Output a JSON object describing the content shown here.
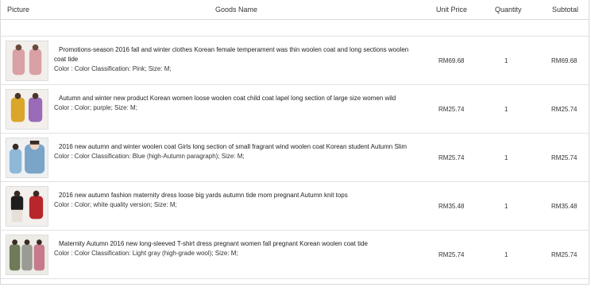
{
  "header": {
    "picture": "Picture",
    "goods_name": "Goods Name",
    "unit_price": "Unit Price",
    "quantity": "Quantity",
    "subtotal": "Subtotal"
  },
  "items": [
    {
      "name": "Promotions-season 2016 fall and winter clothes Korean female temperament was thin woolen coat and long sections woolen coat tide",
      "attrs": "Color : Color Classification: Pink; Size: M;",
      "unit_price": "RM69.68",
      "quantity": "1",
      "subtotal": "RM69.68",
      "thumb_color": "#d9a0a6"
    },
    {
      "name": "Autumn and winter new product Korean women loose woolen coat child coat lapel long section of large size women wild",
      "attrs": "Color : Color; purple; Size: M;",
      "unit_price": "RM25.74",
      "quantity": "1",
      "subtotal": "RM25.74",
      "thumb_color": "#d9a62a"
    },
    {
      "name": "2016 new autumn and winter woolen coat Girls long section of small fragrant wind woolen coat Korean student Autumn Slim",
      "attrs": "Color : Color Classification: Blue (high-Autumn paragraph); Size: M;",
      "unit_price": "RM25.74",
      "quantity": "1",
      "subtotal": "RM25.74",
      "thumb_color": "#8fb8d8"
    },
    {
      "name": "2016 new autumn fashion maternity dress loose big yards autumn tide mom pregnant Autumn knit tops",
      "attrs": "Color : Color; white quality version; Size: M;",
      "unit_price": "RM35.48",
      "quantity": "1",
      "subtotal": "RM35.48",
      "thumb_color": "#b8262c"
    },
    {
      "name": "Maternity Autumn 2016 new long-sleeved T-shirt dress pregnant women fall pregnant Korean woolen coat tide",
      "attrs": "Color : Color Classification: Light gray (high-grade wool); Size: M;",
      "unit_price": "RM25.74",
      "quantity": "1",
      "subtotal": "RM25.74",
      "thumb_color": "#8a8f78"
    }
  ]
}
